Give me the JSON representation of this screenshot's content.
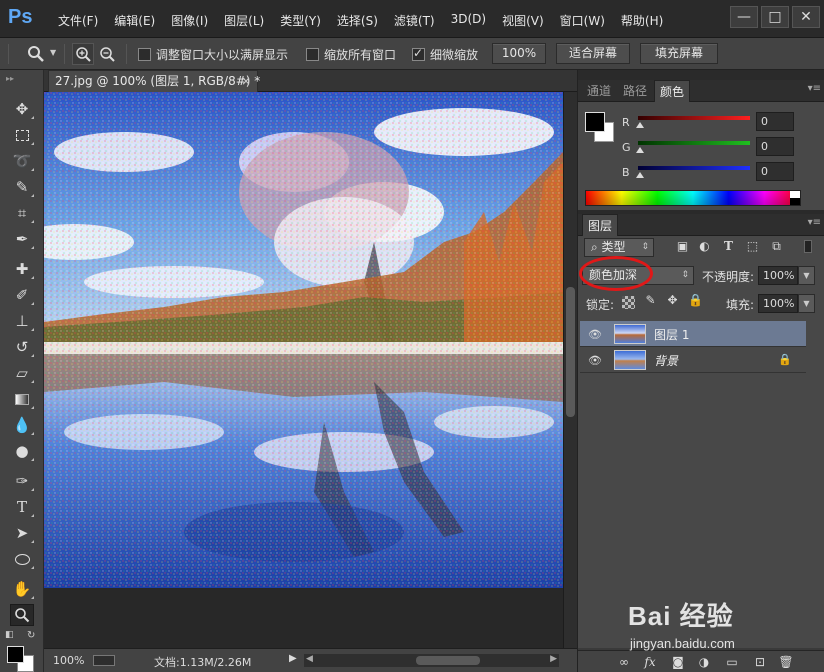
{
  "app": {
    "logo": "Ps"
  },
  "menu": [
    "文件(F)",
    "编辑(E)",
    "图像(I)",
    "图层(L)",
    "类型(Y)",
    "选择(S)",
    "滤镜(T)",
    "3D(D)",
    "视图(V)",
    "窗口(W)",
    "帮助(H)"
  ],
  "window_controls": {
    "minimize": "—",
    "maximize": "□",
    "close": "✕"
  },
  "options": {
    "resize_windows": {
      "label": "调整窗口大小以满屏显示",
      "checked": false
    },
    "zoom_all": {
      "label": "缩放所有窗口",
      "checked": false
    },
    "scrubby_zoom": {
      "label": "细微缩放",
      "checked": true
    },
    "btn_100": "100%",
    "btn_fit": "适合屏幕",
    "btn_fill": "填充屏幕"
  },
  "document": {
    "tab_title": "27.jpg @ 100% (图层 1, RGB/8#) *",
    "tab_close": "×"
  },
  "status": {
    "zoom": "100%",
    "doc_info": "文档:1.13M/2.26M"
  },
  "color_panel": {
    "tabs": [
      "通道",
      "路径",
      "颜色"
    ],
    "active_tab": "颜色",
    "foreground": "#000000",
    "background": "#ffffff",
    "channels": [
      {
        "label": "R",
        "value": "0",
        "color": "#ff2020"
      },
      {
        "label": "G",
        "value": "0",
        "color": "#20c020"
      },
      {
        "label": "B",
        "value": "0",
        "color": "#2030ff"
      }
    ]
  },
  "layers_panel": {
    "title": "图层",
    "filter_kind": "类型",
    "blend_mode": "颜色加深",
    "opacity_label": "不透明度:",
    "opacity_value": "100%",
    "lock_label": "锁定:",
    "fill_label": "填充:",
    "fill_value": "100%",
    "layers": [
      {
        "name": "图层 1",
        "selected": true,
        "locked": false
      },
      {
        "name": "背景",
        "selected": false,
        "locked": true
      }
    ],
    "footer_icons": [
      "link-icon",
      "fx-icon",
      "mask-icon",
      "adjustment-icon",
      "group-folder-icon",
      "new-layer-icon",
      "trash-icon"
    ]
  },
  "tools": [
    "move-tool",
    "marquee-tool",
    "lasso-tool",
    "quick-select-tool",
    "crop-tool",
    "eyedropper-tool",
    "healing-brush-tool",
    "brush-tool",
    "clone-stamp-tool",
    "history-brush-tool",
    "eraser-tool",
    "gradient-tool",
    "blur-tool",
    "dodge-tool",
    "pen-tool",
    "type-tool",
    "path-select-tool",
    "ellipse-tool",
    "hand-tool",
    "zoom-tool"
  ],
  "watermark": {
    "brand": "Bai 经验",
    "url": "jingyan.baidu.com"
  }
}
